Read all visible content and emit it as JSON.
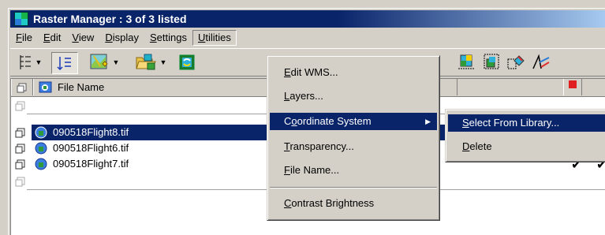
{
  "window": {
    "title": "Raster Manager : 3 of 3 listed"
  },
  "menubar": {
    "items": [
      {
        "label_ul": "F",
        "label_rest": "ile"
      },
      {
        "label_ul": "E",
        "label_rest": "dit"
      },
      {
        "label_ul": "V",
        "label_rest": "iew"
      },
      {
        "label_ul": "D",
        "label_rest": "isplay"
      },
      {
        "label_ul": "S",
        "label_rest": "ettings"
      },
      {
        "label_ul": "U",
        "label_rest": "tilities"
      }
    ],
    "open_menu": "Utilities"
  },
  "list": {
    "header": {
      "file_name": "File Name"
    },
    "rows": [
      {
        "name": "090518Flight8.tif",
        "selected": true
      },
      {
        "name": "090518Flight6.tif",
        "selected": false
      },
      {
        "name": "090518Flight7.tif",
        "selected": false
      }
    ]
  },
  "utilities_menu": {
    "items": [
      {
        "ul": "E",
        "rest": "dit WMS..."
      },
      {
        "ul": "L",
        "rest": "ayers..."
      },
      {
        "pre": "C",
        "ul": "o",
        "rest": "ordinate System"
      },
      {
        "ul": "T",
        "rest": "ransparency..."
      },
      {
        "ul": "F",
        "rest": "ile Name..."
      },
      {
        "ul": "C",
        "rest": "ontrast Brightness"
      }
    ]
  },
  "coordinate_submenu": {
    "items": [
      {
        "ul": "S",
        "rest": "elect From Library..."
      },
      {
        "ul": "D",
        "rest": "elete"
      }
    ]
  },
  "colors": {
    "title_bar": "#0a246a",
    "selection": "#0a246a",
    "face": "#d4d0c8"
  }
}
